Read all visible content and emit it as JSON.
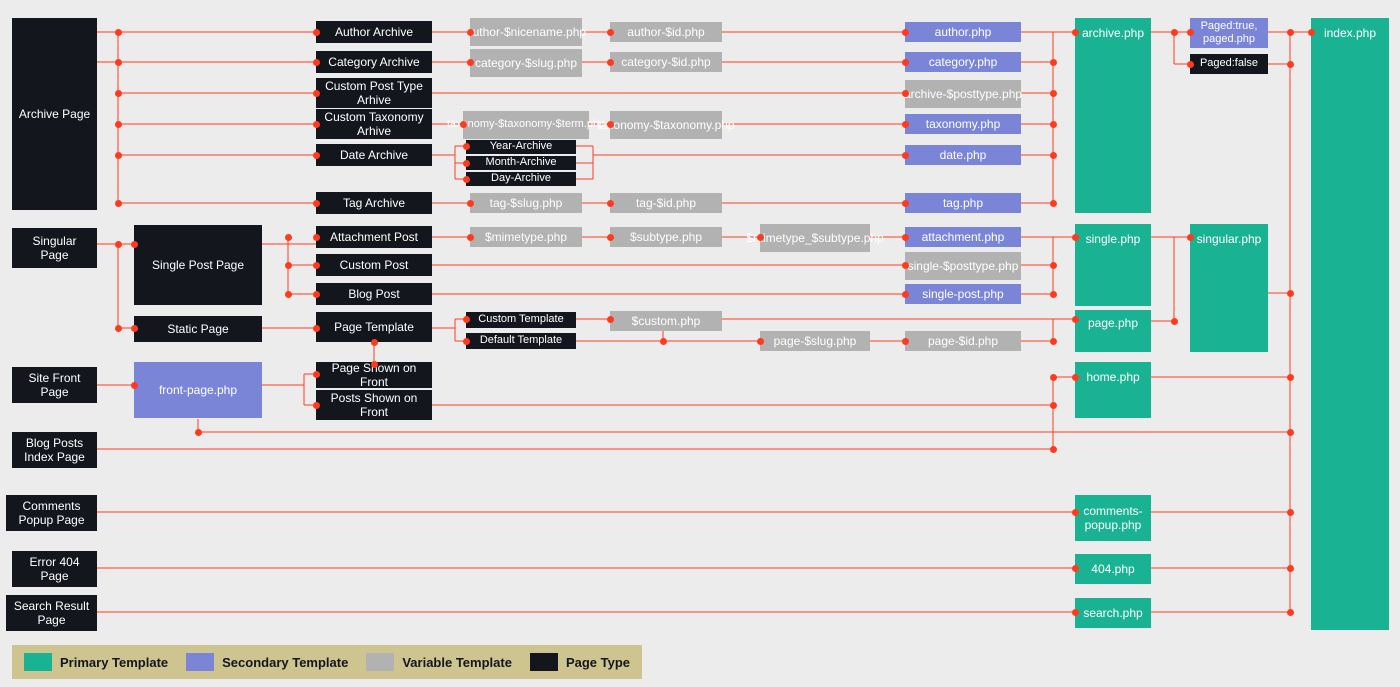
{
  "col1": {
    "archive": "Archive Page",
    "singular": "Singular Page",
    "sitefront": "Site Front Page",
    "blogposts": "Blog Posts Index Page",
    "comments": "Comments Popup Page",
    "error404": "Error 404 Page",
    "search": "Search Result Page"
  },
  "col2": {
    "singlepost": "Single Post Page",
    "staticpage": "Static Page",
    "frontpage": "front-page.php"
  },
  "col3": {
    "author": "Author Archive",
    "category": "Category Archive",
    "cpt": "Custom Post Type Arhive",
    "ctax": "Custom Taxonomy Arhive",
    "date": "Date Archive",
    "tag": "Tag Archive",
    "attach": "Attachment Post",
    "custompost": "Custom Post",
    "blogpost": "Blog Post",
    "pagetmpl": "Page Template",
    "pageshown": "Page Shown on Front",
    "postsshown": "Posts Shown on Front"
  },
  "col4": {
    "author_nicename": "author-$nicename.php",
    "category_slug": "category-$slug.php",
    "taxonomy_term": "taxonomy-$taxonomy-$term.php",
    "year": "Year-Archive",
    "month": "Month-Archive",
    "day": "Day-Archive",
    "tag_slug": "tag-$slug.php",
    "mimetype": "$mimetype.php",
    "customtmpl": "Custom Template",
    "defaulttmpl": "Default Template"
  },
  "col5": {
    "author_id": "author-$id.php",
    "category_id": "category-$id.php",
    "taxonomy_taxonomy": "taxonomy-$taxonomy.php",
    "tag_id": "tag-$id.php",
    "subtype": "$subtype.php",
    "custom": "$custom.php"
  },
  "col6": {
    "mimesubtype": "$mimetype_$subtype.php",
    "page_slug": "page-$slug.php"
  },
  "col7": {
    "author": "author.php",
    "category": "category.php",
    "archive_posttype": "archive-$posttype.php",
    "taxonomy": "taxonomy.php",
    "date": "date.php",
    "tag": "tag.php",
    "attachment": "attachment.php",
    "single_posttype": "single-$posttype.php",
    "single_post": "single-post.php",
    "page_id": "page-$id.php"
  },
  "col8": {
    "archive": "archive.php",
    "single": "single.php",
    "page": "page.php",
    "home": "home.php",
    "comments": "comments-popup.php",
    "c404": "404.php",
    "search": "search.php"
  },
  "col9": {
    "paged_true": "Paged:true, paged.php",
    "paged_false": "Paged:false",
    "singular": "singular.php"
  },
  "col10": {
    "index": "index.php"
  },
  "legend": {
    "primary": "Primary Template",
    "secondary": "Secondary Template",
    "variable": "Variable Template",
    "pagetype": "Page Type"
  }
}
